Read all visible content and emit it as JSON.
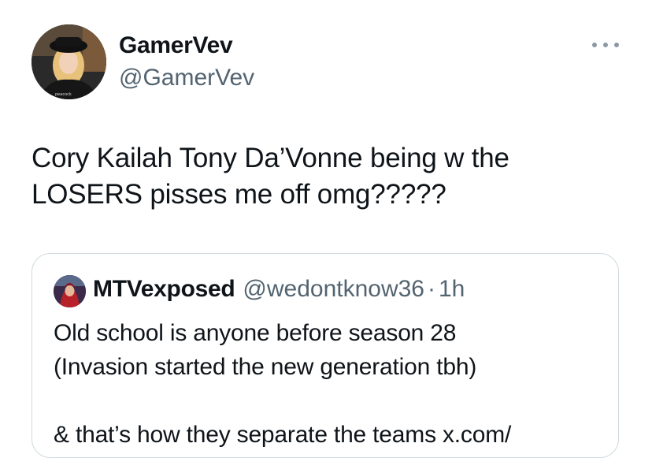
{
  "author": {
    "display_name": "GamerVev",
    "handle": "@GamerVev",
    "avatar_icon": "avatar-woman-blonde-hat",
    "avatar_watermark": "peacock"
  },
  "more_icon": "more-horizontal-icon",
  "tweet": {
    "text": "Cory Kailah Tony Da’Vonne being w the\nLOSERS pisses me off omg?????"
  },
  "quoted_tweet": {
    "display_name": "MTVexposed",
    "handle": "@wedontknow36",
    "separator": "·",
    "time": "1h",
    "avatar_icon": "avatar-character-red",
    "text": "Old school is anyone before season 28\n(Invasion started the new generation tbh)\n\n& that’s how they separate the teams x.com/"
  },
  "colors": {
    "text": "#0f1419",
    "secondary": "#536471",
    "border": "#cfd9de"
  }
}
